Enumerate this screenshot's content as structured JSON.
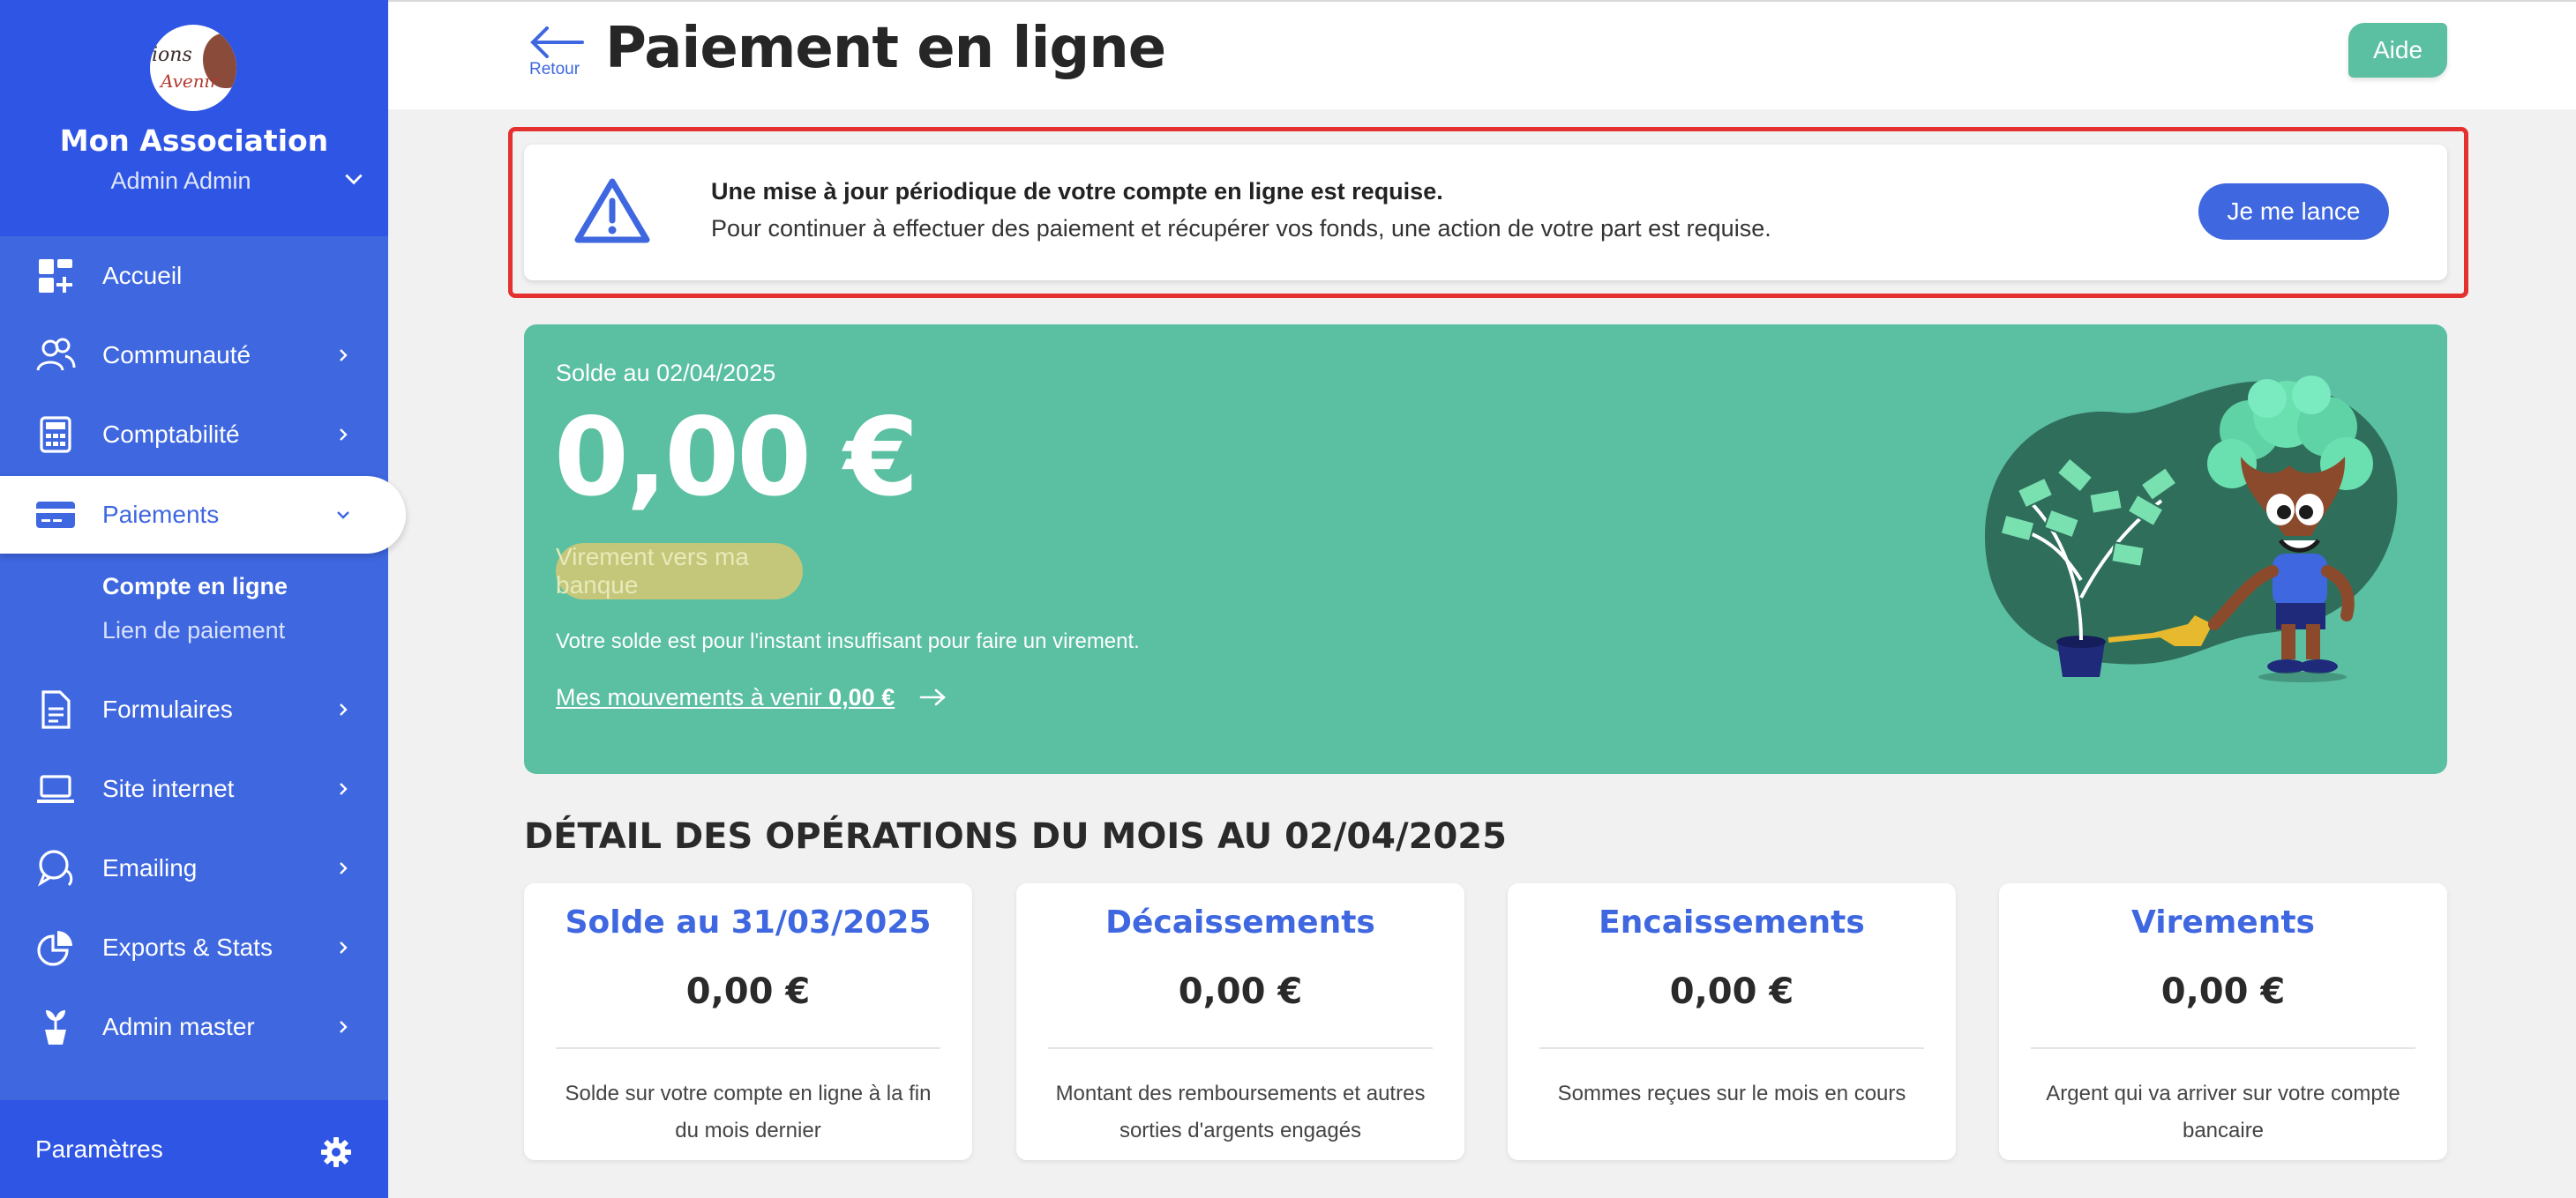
{
  "sidebar": {
    "logo_text_1": "ions",
    "logo_text_2": "Avenir",
    "org_name": "Mon Association",
    "user_name": "Admin Admin",
    "items": [
      {
        "label": "Accueil",
        "icon": "dashboard-icon"
      },
      {
        "label": "Communauté",
        "icon": "users-icon"
      },
      {
        "label": "Comptabilité",
        "icon": "calculator-icon"
      },
      {
        "label": "Paiements",
        "icon": "credit-card-icon",
        "active": true
      },
      {
        "label": "Formulaires",
        "icon": "document-icon"
      },
      {
        "label": "Site internet",
        "icon": "laptop-icon"
      },
      {
        "label": "Emailing",
        "icon": "chat-icon"
      },
      {
        "label": "Exports & Stats",
        "icon": "pie-chart-icon"
      },
      {
        "label": "Admin master",
        "icon": "plant-icon"
      }
    ],
    "sub_items": [
      "Compte en ligne",
      "Lien de paiement"
    ],
    "footer_label": "Paramètres"
  },
  "header": {
    "back_label": "Retour",
    "title": "Paiement en ligne",
    "help_label": "Aide"
  },
  "alert": {
    "title": "Une mise à jour périodique de votre compte en ligne est requise.",
    "text": "Pour continuer à effectuer des paiement et récupérer vos fonds, une action de votre part est requise.",
    "button": "Je me lance"
  },
  "balance": {
    "date_label": "Solde au 02/04/2025",
    "amount": "0,00 €",
    "transfer_button": "Virement vers ma banque",
    "note": "Votre solde est pour l'instant insuffisant pour faire un virement.",
    "upcoming_label": "Mes mouvements à venir",
    "upcoming_amount": "0,00 €"
  },
  "section_title": "DÉTAIL DES OPÉRATIONS DU MOIS AU 02/04/2025",
  "stats": [
    {
      "title": "Solde au 31/03/2025",
      "value": "0,00 €",
      "desc": "Solde sur votre compte en ligne à la fin du mois dernier"
    },
    {
      "title": "Décaissements",
      "value": "0,00 €",
      "desc": "Montant des remboursements et autres sorties d'argents engagés"
    },
    {
      "title": "Encaissements",
      "value": "0,00 €",
      "desc": "Sommes reçues sur le mois en cours"
    },
    {
      "title": "Virements",
      "value": "0,00 €",
      "desc": "Argent qui va arriver sur votre compte bancaire"
    }
  ],
  "colors": {
    "primary": "#3e67e0",
    "sidebar_header": "#2f55e4",
    "green": "#5bbfa2",
    "alert_outline": "#e53030"
  }
}
